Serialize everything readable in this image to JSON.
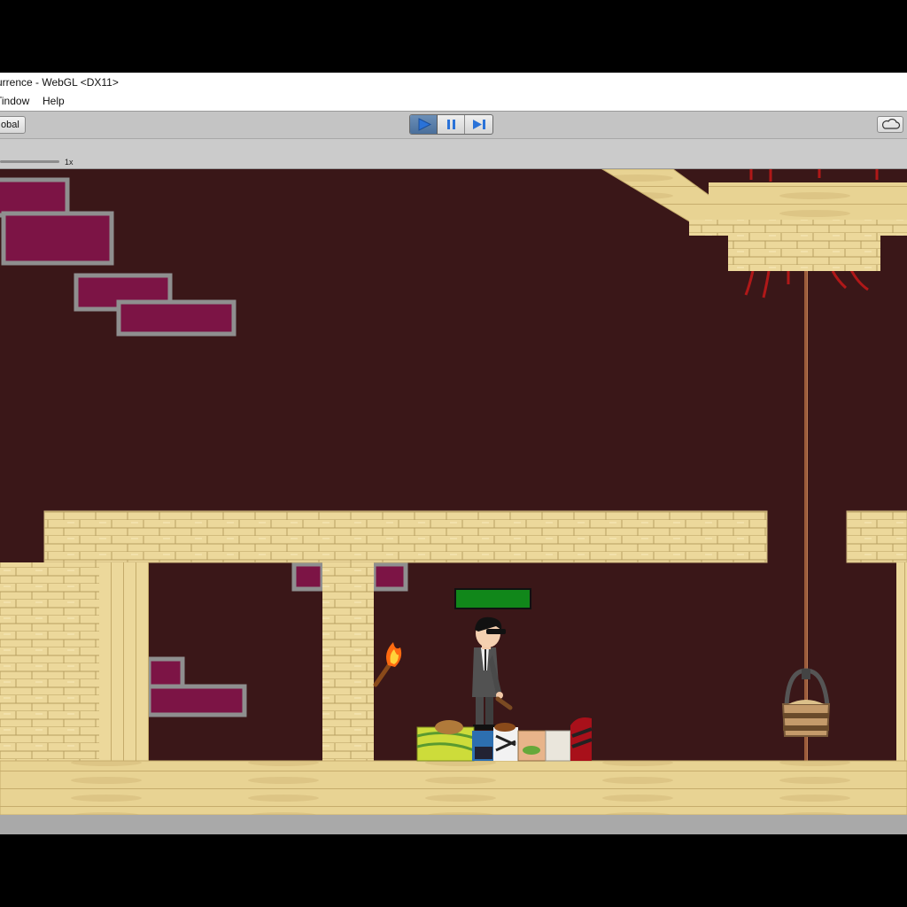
{
  "window": {
    "title": "urrence - WebGL <DX11>"
  },
  "menu": {
    "items": [
      "Window",
      "Help"
    ],
    "window_visible": "Tindow"
  },
  "toolbar": {
    "global_label": "obal"
  },
  "playback": {
    "play_active": true
  },
  "game_view": {
    "scale_label": "1x"
  },
  "player": {
    "health_fraction": 1.0
  },
  "colors": {
    "background": "#3a1718",
    "brick_sand": "#ecd89b",
    "health_green": "#11871a",
    "accent_blue": "#2a72d8"
  },
  "icons": [
    "play-icon",
    "pause-icon",
    "step-icon",
    "cloud-icon",
    "torch-icon"
  ]
}
